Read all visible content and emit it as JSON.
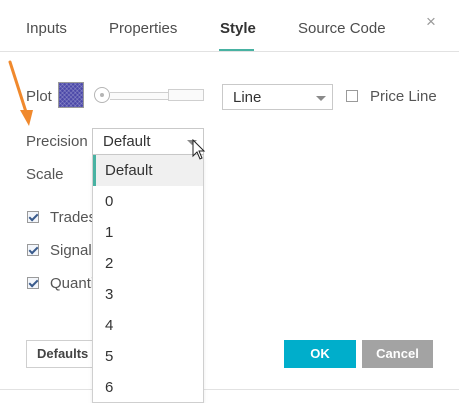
{
  "tabs": [
    {
      "label": "Inputs"
    },
    {
      "label": "Properties"
    },
    {
      "label": "Style"
    },
    {
      "label": "Source Code"
    }
  ],
  "close_symbol": "×",
  "plot": {
    "label": "Plot",
    "color": "#4b48a8",
    "line_style": "Line",
    "price_line_label": "Price Line",
    "price_line_checked": false
  },
  "precision": {
    "label": "Precision",
    "value": "Default",
    "options": [
      "Default",
      "0",
      "1",
      "2",
      "3",
      "4",
      "5",
      "6"
    ]
  },
  "scale": {
    "label": "Scale"
  },
  "checkboxes": [
    {
      "label": "Trades",
      "checked": true
    },
    {
      "label": "Signal",
      "checked": true
    },
    {
      "label": "Quanti",
      "checked": true
    }
  ],
  "footer": {
    "defaults_label": "Defaults",
    "ok_label": "OK",
    "cancel_label": "Cancel"
  },
  "colors": {
    "accent": "#48b2a2",
    "ok_button": "#00aecb",
    "cancel_button": "#a3a3a3",
    "annotation_arrow": "#f0892d"
  }
}
